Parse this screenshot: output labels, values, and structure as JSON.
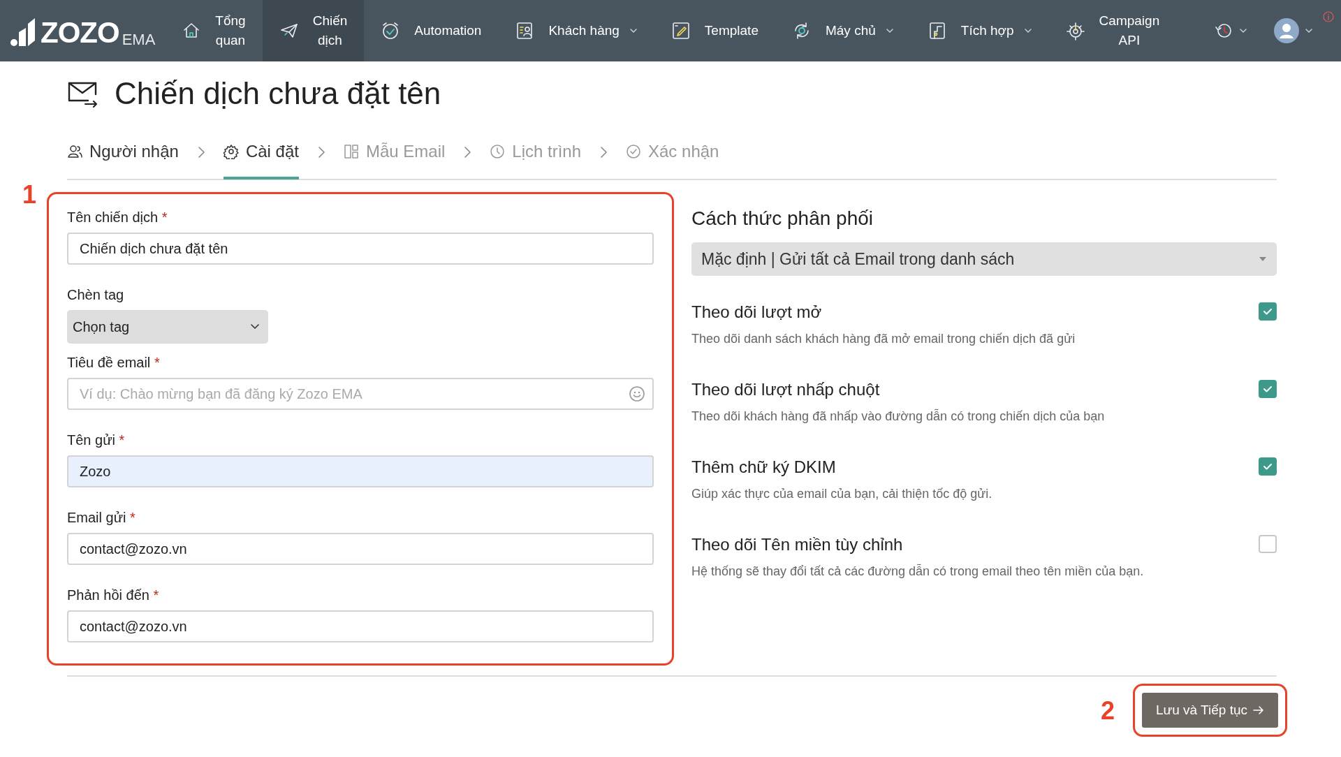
{
  "nav": {
    "logo": {
      "brand": "ZOZO",
      "suffix": "EMA"
    },
    "items": [
      {
        "label": "Tổng quan",
        "selected": false,
        "dropdown": false,
        "compact": true
      },
      {
        "label": "Chiến dịch",
        "selected": true,
        "dropdown": false,
        "compact": true
      },
      {
        "label": "Automation",
        "selected": false,
        "dropdown": false,
        "compact": false
      },
      {
        "label": "Khách hàng",
        "selected": false,
        "dropdown": true,
        "compact": false
      },
      {
        "label": "Template",
        "selected": false,
        "dropdown": false,
        "compact": false
      },
      {
        "label": "Máy chủ",
        "selected": false,
        "dropdown": true,
        "compact": false
      },
      {
        "label": "Tích hợp",
        "selected": false,
        "dropdown": true,
        "compact": false
      },
      {
        "label": "Campaign API",
        "selected": false,
        "dropdown": false,
        "compact": true
      }
    ]
  },
  "page": {
    "title": "Chiến dịch chưa đặt tên"
  },
  "steps": [
    {
      "label": "Người nhận",
      "selected": false,
      "upcoming": false
    },
    {
      "label": "Cài đặt",
      "selected": true,
      "upcoming": false
    },
    {
      "label": "Mẫu Email",
      "selected": false,
      "upcoming": true
    },
    {
      "label": "Lịch trình",
      "selected": false,
      "upcoming": true
    },
    {
      "label": "Xác nhận",
      "selected": false,
      "upcoming": true
    }
  ],
  "form": {
    "fields": [
      {
        "kind": "text",
        "label": "Tên chiến dịch",
        "required_mark": "*",
        "value": "Chiến dịch chưa đặt tên"
      },
      {
        "kind": "select",
        "label": "Chèn tag",
        "value": "Chọn tag"
      },
      {
        "kind": "emoji",
        "label": "Tiêu đề email",
        "required_mark": "*",
        "placeholder": "Ví dụ: Chào mừng bạn đã đăng ký Zozo EMA"
      },
      {
        "kind": "text",
        "label": "Tên gửi",
        "required_mark": "*",
        "value": "Zozo",
        "autofilled": true
      },
      {
        "kind": "text",
        "label": "Email gửi",
        "required_mark": "*",
        "value": "contact@zozo.vn"
      },
      {
        "kind": "text",
        "label": "Phản hồi đến",
        "required_mark": "*",
        "value": "contact@zozo.vn"
      }
    ]
  },
  "distribution": {
    "title": "Cách thức phân phối",
    "select_value": "Mặc định | Gửi tất cả Email trong danh sách",
    "options": [
      {
        "title": "Theo dõi lượt mở",
        "description": "Theo dõi danh sách khách hàng đã mở email trong chiến dịch đã gửi",
        "checked": true
      },
      {
        "title": "Theo dõi lượt nhấp chuột",
        "description": "Theo dõi khách hàng đã nhấp vào đường dẫn có trong chiến dịch của bạn",
        "checked": true
      },
      {
        "title": "Thêm chữ ký DKIM",
        "description": "Giúp xác thực của email của bạn, cải thiện tốc độ gửi.",
        "checked": true
      },
      {
        "title": "Theo dõi Tên miền tùy chỉnh",
        "description": "Hệ thống sẽ thay đổi tất cả các đường dẫn có trong email theo tên miền của bạn.",
        "checked": false
      }
    ]
  },
  "footer": {
    "button": "Lưu và Tiếp tục"
  },
  "annotations": [
    {
      "label": "1"
    },
    {
      "label": "2"
    }
  ]
}
